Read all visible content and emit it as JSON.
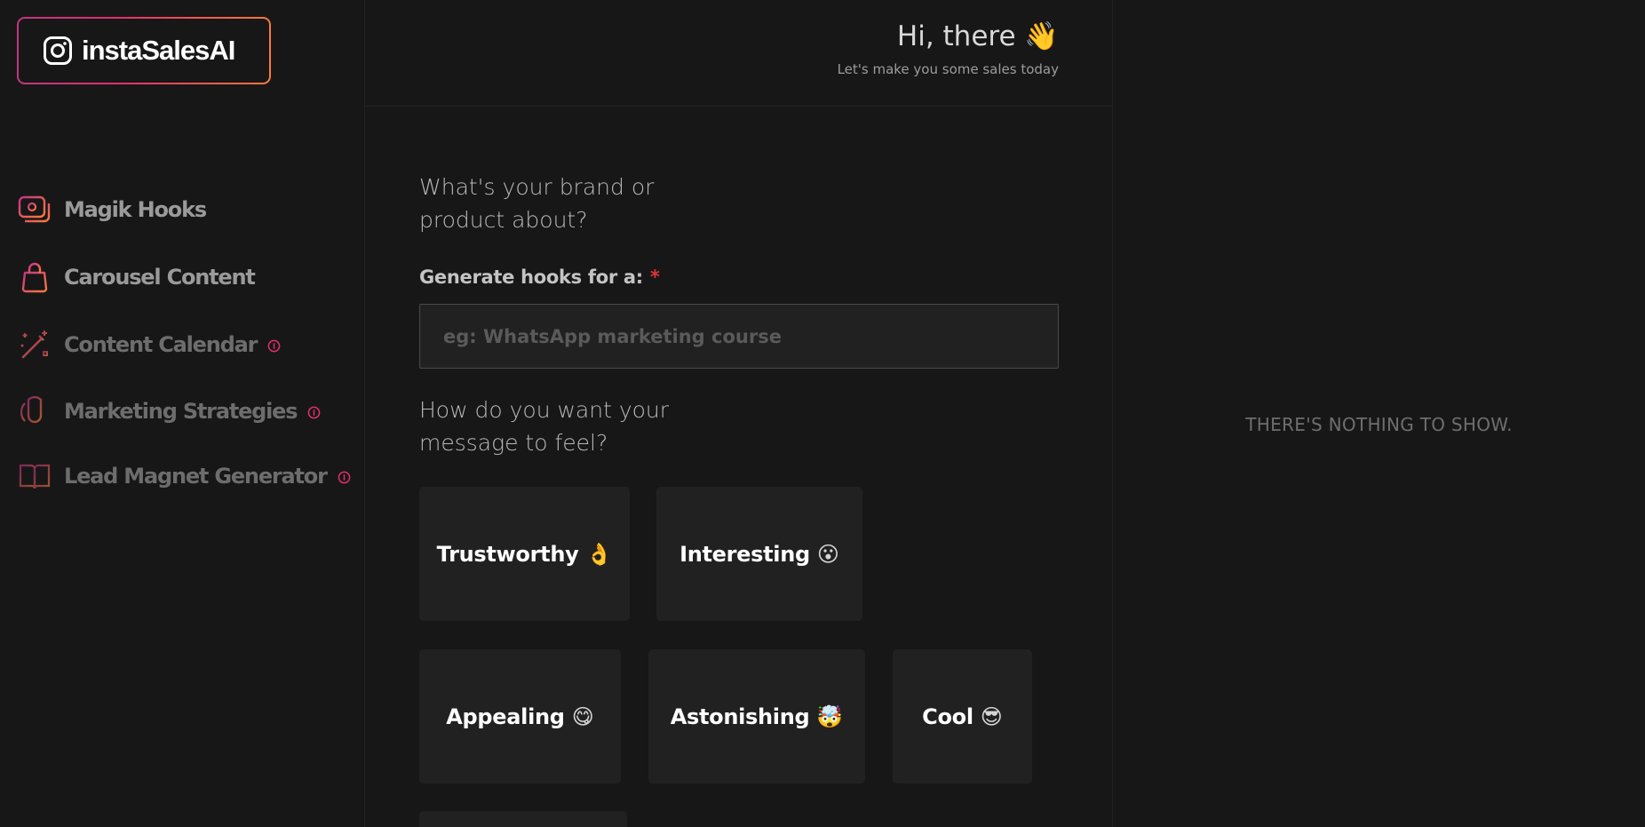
{
  "brand": {
    "name": "instaSalesAI",
    "icon": "instagram-icon"
  },
  "sidebar": {
    "items": [
      {
        "label": "Magik Hooks",
        "icon": "hook-icon"
      },
      {
        "label": "Carousel Content",
        "icon": "bag-icon"
      },
      {
        "label": "Content Calendar",
        "icon": "magic-wand-icon",
        "badge_icon": "info-icon"
      },
      {
        "label": "Marketing Strategies",
        "icon": "strategy-icon",
        "badge_icon": "info-icon"
      },
      {
        "label": "Lead Magnet Generator",
        "icon": "book-icon",
        "badge_icon": "info-icon"
      }
    ]
  },
  "header": {
    "greeting": "Hi, there 👋",
    "subtitle": "Let's make you some sales today"
  },
  "form": {
    "brand_question": "What's your brand or product about?",
    "hooks_label": "Generate hooks for a:",
    "required_mark": "*",
    "hooks_placeholder": "eg: WhatsApp marketing course",
    "tone_question": "How do you want your message to feel?",
    "tones": [
      {
        "label": "Trustworthy",
        "emoji": "👌"
      },
      {
        "label": "Interesting",
        "emoji": "😮"
      },
      {
        "label": "Appealing",
        "emoji": "😋"
      },
      {
        "label": "Astonishing",
        "emoji": "🤯"
      },
      {
        "label": "Cool",
        "emoji": "😎"
      }
    ]
  },
  "output": {
    "empty_message": "THERE'S NOTHING TO SHOW."
  },
  "colors": {
    "background": "#171717",
    "card": "#212121",
    "accent_gradient": [
      "#c13584",
      "#e1306c",
      "#fd7a3c"
    ],
    "required": "#e03434"
  }
}
